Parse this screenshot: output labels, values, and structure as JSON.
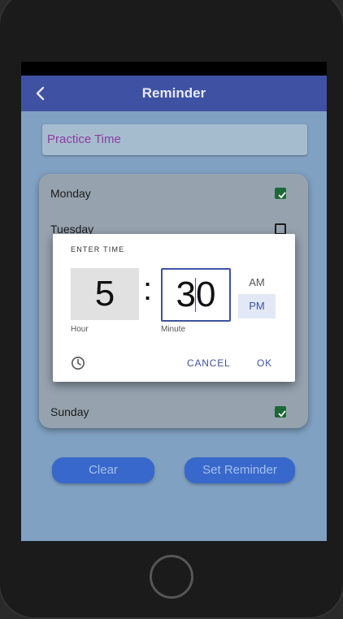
{
  "appbar": {
    "title": "Reminder"
  },
  "reminder_field": {
    "value": "Practice Time"
  },
  "days": [
    {
      "label": "Monday",
      "checked": true
    },
    {
      "label": "Tuesday",
      "checked": false
    },
    {
      "label": "Sunday",
      "checked": true
    }
  ],
  "buttons": {
    "clear": "Clear",
    "set": "Set Reminder"
  },
  "time_dialog": {
    "header": "ENTER TIME",
    "hour": "5",
    "separator": ":",
    "minute": "30",
    "hour_caption": "Hour",
    "minute_caption": "Minute",
    "am": "AM",
    "pm": "PM",
    "selected_period": "PM",
    "cancel": "CANCEL",
    "ok": "OK"
  },
  "colors": {
    "appbar": "#3e51a3",
    "accent": "#3e51a3",
    "checkbox": "#1f6b3a",
    "button": "#3a6bd0"
  }
}
